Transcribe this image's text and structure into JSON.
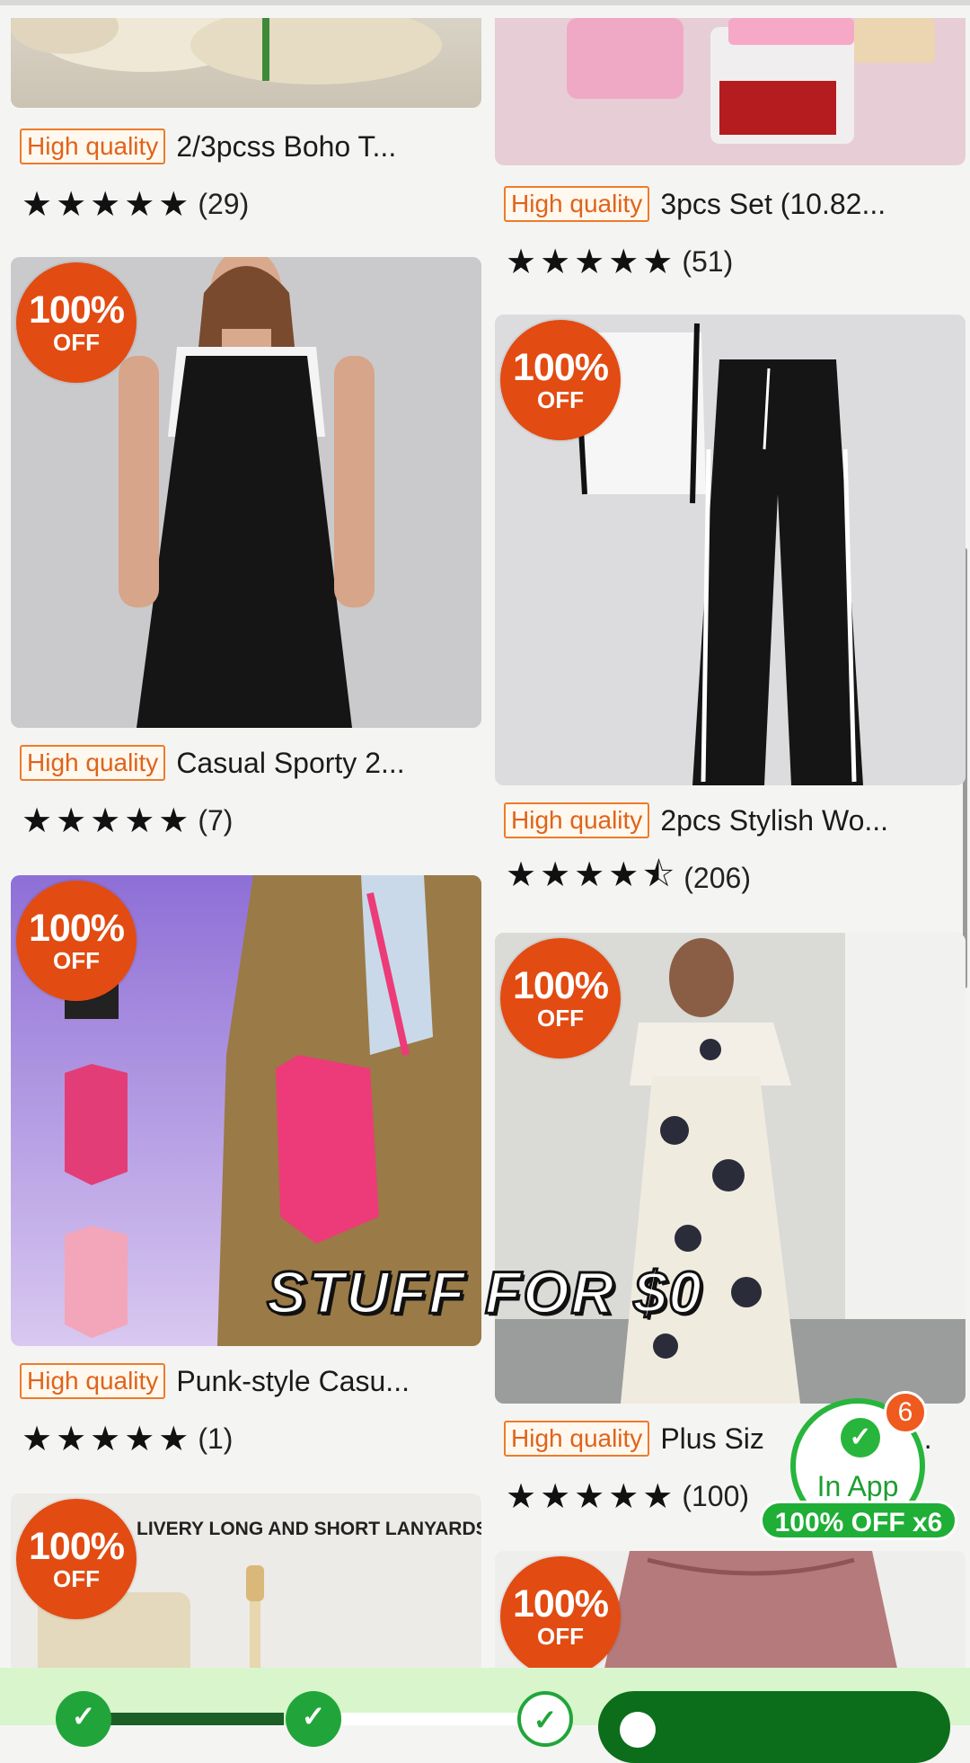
{
  "overlay_caption": "STUFF FOR $0",
  "badge": {
    "percent": "100%",
    "off": "OFF"
  },
  "hq_label": "High quality",
  "left_column": [
    {
      "title": "2/3pcss Boho T...",
      "stars": "★★★★★",
      "count": "(29)",
      "has_badge": false,
      "image": "pillows-photo"
    },
    {
      "title": "Casual Sporty 2...",
      "stars": "★★★★★",
      "count": "(7)",
      "has_badge": true,
      "image": "black-jumpsuit-photo"
    },
    {
      "title": "Punk-style Casu...",
      "stars": "★★★★★",
      "count": "(1)",
      "has_badge": true,
      "image": "coffin-bag-photo"
    },
    {
      "title": "",
      "banner_text": "LIVERY LONG AND SHORT LANYARDS",
      "has_badge": true,
      "image": "lanyard-photo"
    }
  ],
  "right_column": [
    {
      "title": "3pcs Set (10.82...",
      "stars": "★★★★★",
      "count": "(51)",
      "has_badge": false,
      "image": "pink-containers-photo"
    },
    {
      "title": "2pcs Stylish Wo...",
      "stars": "★★★★⯪",
      "count": "(206)",
      "has_badge": true,
      "image": "track-pants-photo"
    },
    {
      "title": "Plus Siz",
      "title_suffix": "...",
      "stars": "★★★★★",
      "count": "(100)",
      "has_badge": true,
      "image": "floral-dress-photo"
    },
    {
      "title": "",
      "has_badge": true,
      "image": "pink-shorts-photo"
    }
  ],
  "in_app": {
    "label": "In App",
    "count": "6",
    "bar": "100% OFF x6"
  },
  "colors": {
    "badge": "#e24b12",
    "hq_border": "#ee7b2a",
    "green": "#28b53b",
    "background": "#f4f5f3"
  }
}
